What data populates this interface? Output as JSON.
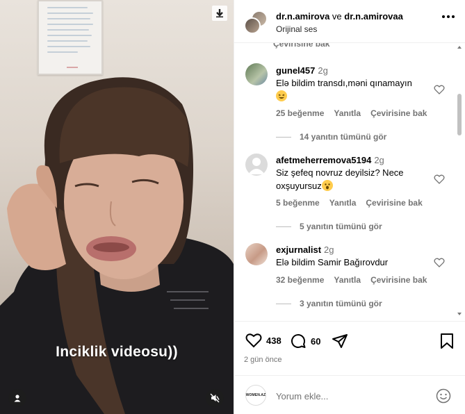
{
  "video": {
    "caption": "Inciklik videosu))",
    "icons": [
      "download-icon",
      "user-icon",
      "mute-icon"
    ]
  },
  "post": {
    "author1": "dr.n.amirova",
    "connector": " ve ",
    "author2": "dr.n.amirovaa",
    "audio": "Orijinal ses"
  },
  "comments": {
    "top_partial": "Çevirisine bak",
    "items": [
      {
        "user": "gunel457",
        "age": "2g",
        "text": "Elə bildim transdı,məni qınamayın",
        "likes": "25 beğenme",
        "reply": "Yanıtla",
        "translate": "Çevirisine bak",
        "replies": "14 yanıtın tümünü gör"
      },
      {
        "user": "afetmeherremova5194",
        "age": "2g",
        "text": "Siz şefeq novruz deyilsiz? Nece oxşuyursuz",
        "likes": "5 beğenme",
        "reply": "Yanıtla",
        "translate": "Çevirisine bak",
        "replies": "5 yanıtın tümünü gör"
      },
      {
        "user": "exjurnalist",
        "age": "2g",
        "text": "Elə bildim Samir Bağırovdur",
        "likes": "32 beğenme",
        "reply": "Yanıtla",
        "translate": "Çevirisine bak",
        "replies": "3 yanıtın tümünü gör"
      }
    ]
  },
  "actions": {
    "like_count": "438",
    "comment_count": "60",
    "time": "2 gün önce"
  },
  "add_comment": {
    "brand": "WOMEN.AZ",
    "placeholder": "Yorum ekle..."
  },
  "colors": {
    "secondary_text": "#737373",
    "divider": "#efefef",
    "scroll_thumb": "#c1c1c1"
  }
}
